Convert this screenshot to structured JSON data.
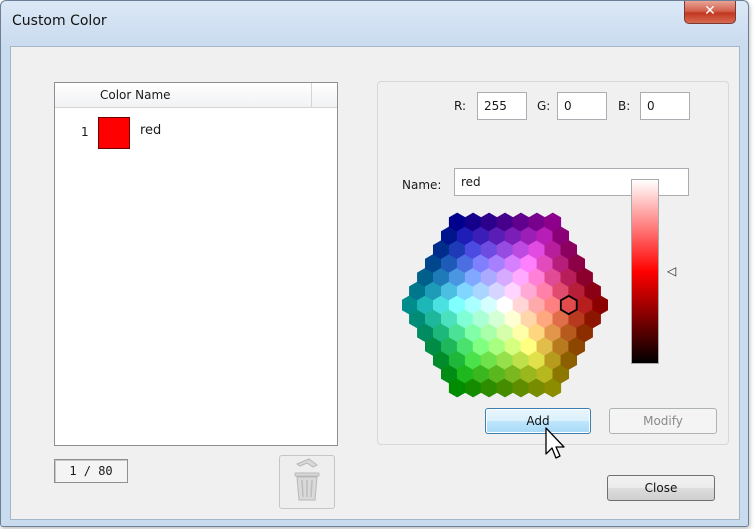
{
  "window": {
    "title": "Custom Color",
    "close_glyph": "✕"
  },
  "list": {
    "column_header": "Color Name",
    "rows": [
      {
        "index": "1",
        "name": "red",
        "swatch_color": "#ff0000"
      }
    ],
    "counter": "1 / 80"
  },
  "rgb": {
    "r_label": "R:",
    "r_value": "255",
    "g_label": "G:",
    "g_value": "0",
    "b_label": "B:",
    "b_value": "0"
  },
  "name_field": {
    "label": "Name:",
    "value": "red"
  },
  "picker": {
    "selected_color": "#ff0000",
    "slider_arrow": "◁",
    "slider_level": 0.5
  },
  "buttons": {
    "add": "Add",
    "modify": "Modify",
    "close": "Close"
  },
  "icons": {
    "trash": "trash-icon",
    "close": "close-icon",
    "cursor": "mouse-cursor-icon",
    "slider_arrow": "triangle-left-icon"
  },
  "colors": {
    "title_close": "#c2371f",
    "focus_border": "#3c7fb1",
    "selection": "#ff0000"
  }
}
